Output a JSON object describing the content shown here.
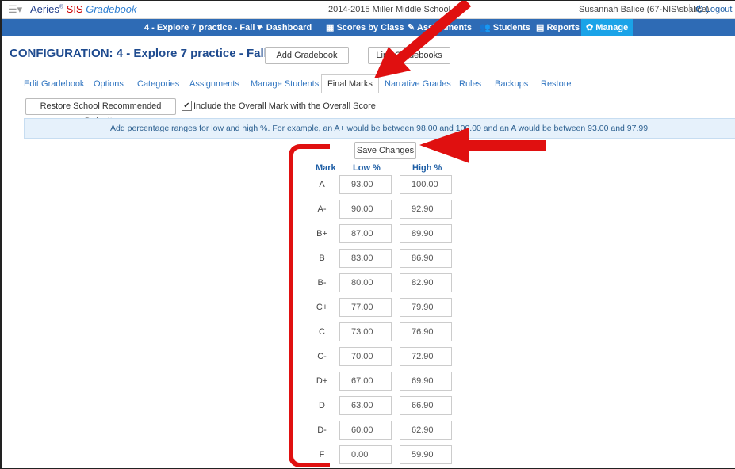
{
  "topbar": {
    "menu_icon": "hamburger-menu-icon",
    "logo_aeries": "Aeries",
    "logo_reg": "®",
    "logo_sis": " SIS ",
    "logo_gradebook": "Gradebook",
    "school": "2014-2015 Miller Middle School",
    "user": "Susannah Balice (67-NIS\\sbalice)",
    "logout": "Logout"
  },
  "nav": {
    "gradebook_select": "4 - Explore 7 practice - Fall ▾",
    "dashboard": "Dashboard",
    "scores_by_class": "Scores by Class",
    "assignments": "Assignments",
    "students": "Students",
    "reports": "Reports",
    "manage": "Manage"
  },
  "config": {
    "title": "CONFIGURATION: 4 - Explore 7 practice - Fall",
    "add_gradebook": "Add Gradebook",
    "link_gradebooks": "Link Gradebooks"
  },
  "tabs": [
    "Edit Gradebook",
    "Options",
    "Categories",
    "Assignments",
    "Manage Students",
    "Final Marks",
    "Narrative Grades",
    "Rules",
    "Backups",
    "Restore"
  ],
  "final_marks": {
    "restore_defaults": "Restore School Recommended Defaults",
    "include_overall_checked": true,
    "include_overall_label": "Include the Overall Mark with the Overall Score",
    "info": "Add percentage ranges for low and high %. For example, an A+ would be between 98.00 and 100.00 and an A would be between 93.00 and 97.99.",
    "save_changes": "Save Changes",
    "headers": {
      "mark": "Mark",
      "low": "Low %",
      "high": "High %"
    },
    "rows": [
      {
        "mark": "A",
        "low": "93.00",
        "high": "100.00"
      },
      {
        "mark": "A-",
        "low": "90.00",
        "high": "92.90"
      },
      {
        "mark": "B+",
        "low": "87.00",
        "high": "89.90"
      },
      {
        "mark": "B",
        "low": "83.00",
        "high": "86.90"
      },
      {
        "mark": "B-",
        "low": "80.00",
        "high": "82.90"
      },
      {
        "mark": "C+",
        "low": "77.00",
        "high": "79.90"
      },
      {
        "mark": "C",
        "low": "73.00",
        "high": "76.90"
      },
      {
        "mark": "C-",
        "low": "70.00",
        "high": "72.90"
      },
      {
        "mark": "D+",
        "low": "67.00",
        "high": "69.90"
      },
      {
        "mark": "D",
        "low": "63.00",
        "high": "66.90"
      },
      {
        "mark": "D-",
        "low": "60.00",
        "high": "62.90"
      },
      {
        "mark": "F",
        "low": "0.00",
        "high": "59.90"
      }
    ]
  },
  "colors": {
    "nav_bg": "#2e6bb5",
    "nav_active": "#1aa3e8",
    "title": "#1f4b8f",
    "annotation_red": "#e01010"
  }
}
